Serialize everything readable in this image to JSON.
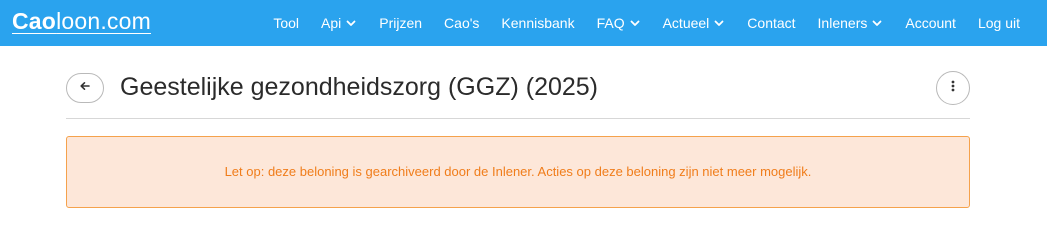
{
  "navbar": {
    "logo_part1": "Cao",
    "logo_part2": "loon.com",
    "items": [
      {
        "label": "Tool",
        "dropdown": false
      },
      {
        "label": "Api",
        "dropdown": true
      },
      {
        "label": "Prijzen",
        "dropdown": false
      },
      {
        "label": "Cao's",
        "dropdown": false
      },
      {
        "label": "Kennisbank",
        "dropdown": false
      },
      {
        "label": "FAQ",
        "dropdown": true
      },
      {
        "label": "Actueel",
        "dropdown": true
      },
      {
        "label": "Contact",
        "dropdown": false
      },
      {
        "label": "Inleners",
        "dropdown": true
      },
      {
        "label": "Account",
        "dropdown": false
      },
      {
        "label": "Log uit",
        "dropdown": false
      }
    ],
    "color": "#2aa3ee"
  },
  "page": {
    "title": "Geestelijke gezondheidszorg (GGZ) (2025)",
    "back_icon": "arrow-left-icon",
    "more_icon": "vertical-dots-icon"
  },
  "alert": {
    "text": "Let op: deze beloning is gearchiveerd door de Inlener. Acties op deze beloning zijn niet meer mogelijk.",
    "color": "#f07d1b",
    "background": "#fde7d9"
  }
}
